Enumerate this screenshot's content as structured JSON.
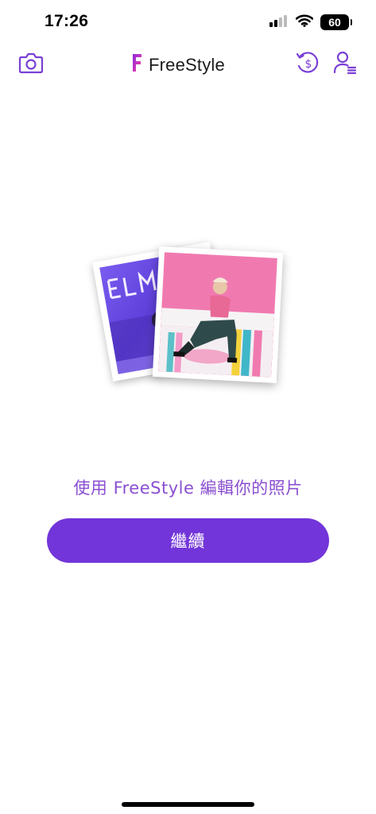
{
  "status_bar": {
    "time": "17:26",
    "battery": "60"
  },
  "header": {
    "app_name": "FreeStyle",
    "left_icon": "camera-icon",
    "right_icons": [
      "refund-dollar-icon",
      "account-menu-icon"
    ]
  },
  "main": {
    "tagline": "使用 FreeStyle 編輯你的照片",
    "continue_label": "繼續"
  },
  "colors": {
    "accent": "#7235d9",
    "tagline": "#8a4fd1",
    "icon": "#7a3fd6"
  }
}
